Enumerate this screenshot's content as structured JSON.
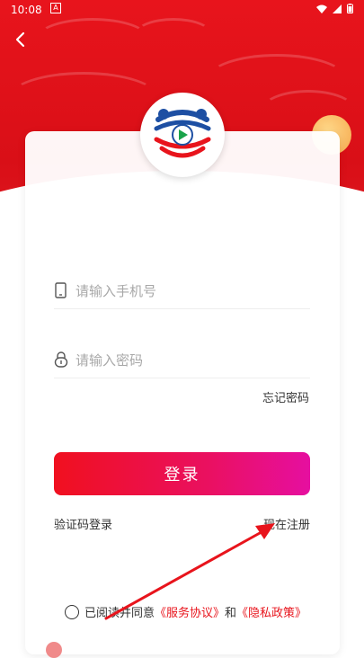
{
  "status_bar": {
    "time": "10:08",
    "app_indicator": "A"
  },
  "nav": {
    "back_icon": "chevron-left-icon"
  },
  "form": {
    "phone_placeholder": "请输入手机号",
    "password_placeholder": "请输入密码",
    "forgot_password": "忘记密码",
    "login_button": "登录",
    "sms_login": "验证码登录",
    "register": "现在注册"
  },
  "agreement": {
    "prefix": "已阅读并同意",
    "service_link": "《服务协议》",
    "and": "和",
    "privacy_link": "《隐私政策》"
  },
  "colors": {
    "brand_red": "#e8141c",
    "button_gradient_start": "#f0101f",
    "button_gradient_end": "#e60fa0",
    "annotation_arrow": "#e8141c"
  }
}
